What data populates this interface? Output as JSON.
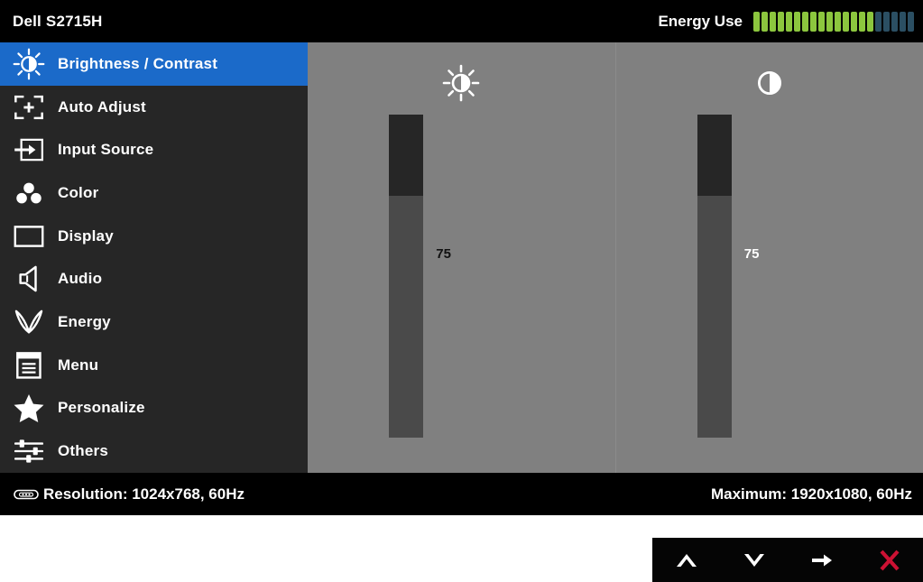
{
  "osd": {
    "title": "Dell S2715H",
    "energy": {
      "label": "Energy Use",
      "total_segments": 20,
      "active_segments": 15,
      "active_color": "#8cc63e",
      "inactive_color": "#2b4f63"
    },
    "sidebar": {
      "items": [
        {
          "label": "Brightness / Contrast",
          "icon": "brightness-icon",
          "active": true
        },
        {
          "label": "Auto Adjust",
          "icon": "auto-adjust-icon",
          "active": false
        },
        {
          "label": "Input Source",
          "icon": "input-source-icon",
          "active": false
        },
        {
          "label": "Color",
          "icon": "color-icon",
          "active": false
        },
        {
          "label": "Display",
          "icon": "display-icon",
          "active": false
        },
        {
          "label": "Audio",
          "icon": "audio-icon",
          "active": false
        },
        {
          "label": "Energy",
          "icon": "energy-leaf-icon",
          "active": false
        },
        {
          "label": "Menu",
          "icon": "menu-icon",
          "active": false
        },
        {
          "label": "Personalize",
          "icon": "star-icon",
          "active": false
        },
        {
          "label": "Others",
          "icon": "sliders-icon",
          "active": false
        }
      ],
      "highlight_color": "#1b6ac9",
      "background_color": "#262626"
    },
    "panels": [
      {
        "name": "brightness",
        "icon": "brightness-icon",
        "value": "75",
        "percent": 75,
        "value_text_color": "#111111"
      },
      {
        "name": "contrast",
        "icon": "contrast-icon",
        "value": "75",
        "percent": 75,
        "value_text_color": "#ffffff"
      }
    ],
    "status": {
      "resolution_icon": "vga-connector-icon",
      "resolution": "Resolution: 1024x768, 60Hz",
      "maximum": "Maximum: 1920x1080, 60Hz"
    }
  },
  "navbar": {
    "buttons": [
      {
        "name": "up-button",
        "icon": "chevron-up-icon",
        "color": "#ffffff"
      },
      {
        "name": "down-button",
        "icon": "chevron-down-icon",
        "color": "#ffffff"
      },
      {
        "name": "enter-button",
        "icon": "arrow-right-icon",
        "color": "#ffffff"
      },
      {
        "name": "exit-button",
        "icon": "close-x-icon",
        "color": "#cc1133"
      }
    ]
  }
}
